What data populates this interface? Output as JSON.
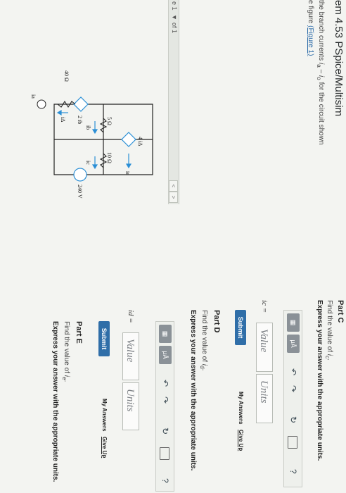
{
  "header": {
    "title": "em 4.53 PSpice/Multisim"
  },
  "problem": {
    "line1_a": "the branch currents ",
    "line1_var1": "i",
    "line1_sub1": "a",
    "line1_b": " – ",
    "line1_var2": "i",
    "line1_sub2": "o",
    "line1_c": " for the circuit shown",
    "line2_a": "e figure ",
    "figure_link": "(Figure 1)"
  },
  "figure_nav": {
    "figure_label": "e 1",
    "dropdown_arrow": "▼",
    "of_label": "of 1",
    "prev": "<",
    "next": ">"
  },
  "circuit": {
    "res_40": "40 Ω",
    "res_5": "5 Ω",
    "res_10": "10 Ω",
    "dep_source_1": "4 iΔ",
    "dep_source_2": "2 ib",
    "voltage_source": "240 V",
    "current_ia": "ia",
    "current_ib": "ib",
    "current_ic": "ic",
    "current_id": "iΔ",
    "current_ie": "ie"
  },
  "part_c": {
    "label": "Part C",
    "prompt_a": "Find the value of ",
    "prompt_var": "i",
    "prompt_sub": "c",
    "prompt_b": ".",
    "instruction": "Express your answer with the appropriate units.",
    "var_label": "ic =",
    "value_placeholder": "Value",
    "units_placeholder": "Units",
    "submit_label": "Submit",
    "my_answers": "My Answers",
    "give_up": "Give Up"
  },
  "part_d": {
    "label": "Part D",
    "prompt_a": "Find the value of ",
    "prompt_var": "i",
    "prompt_sub": "d",
    "prompt_b": ".",
    "instruction": "Express your answer with the appropriate units.",
    "var_label": "id =",
    "value_placeholder": "Value",
    "units_placeholder": "Units",
    "submit_label": "Submit",
    "my_answers": "My Answers",
    "give_up": "Give Up"
  },
  "part_e": {
    "label": "Part E",
    "prompt_a": "Find the value of ",
    "prompt_var": "i",
    "prompt_sub": "e",
    "prompt_b": ".",
    "instruction": "Express your answer with the appropriate units."
  },
  "toolbar": {
    "template_icon": "template-icon",
    "units_label": "μÅ",
    "undo_icon": "↶",
    "redo_icon": "↷",
    "reset_icon": "↻",
    "keyboard_icon": "keyboard-icon",
    "help_label": "?"
  },
  "colors": {
    "link": "#2a6aa8",
    "submit": "#2f6ea8",
    "circuit_highlight": "#2b8fd6"
  }
}
